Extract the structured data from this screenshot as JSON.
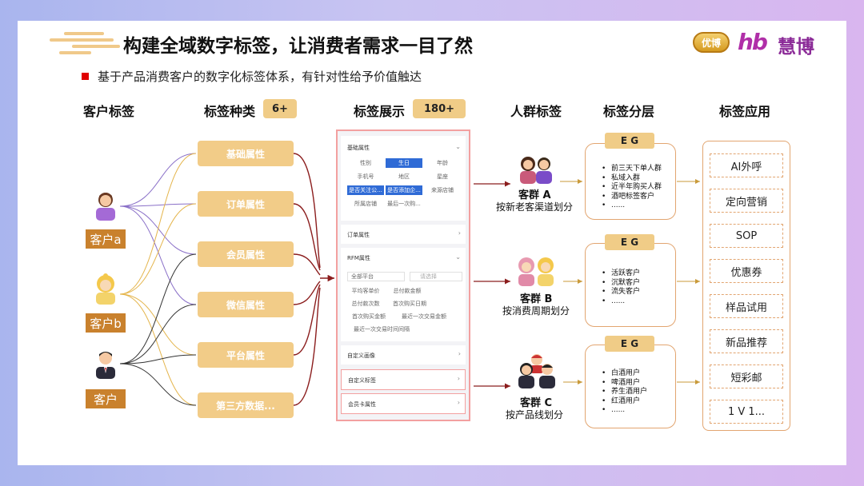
{
  "title": "构建全域数字标签，让消费者需求一目了然",
  "subtitle": "基于产品消费客户的数字化标签体系，有针对性给予价值触达",
  "logos": {
    "youbo": "优博",
    "hb": "hb",
    "huibo": "慧博"
  },
  "columns": {
    "customer_tags": "客户标签",
    "tag_types": "标签种类",
    "tag_types_badge": "6+",
    "tag_display": "标签展示",
    "tag_display_badge": "180+",
    "crowd_tags": "人群标签",
    "tag_layers": "标签分层",
    "tag_apps": "标签应用"
  },
  "customers": [
    {
      "label": "客户a",
      "icon": "woman-avatar-icon"
    },
    {
      "label": "客户b",
      "icon": "blonde-avatar-icon"
    },
    {
      "label": "客户",
      "icon": "man-in-suit-avatar-icon"
    }
  ],
  "categories": [
    "基础属性",
    "订单属性",
    "会员属性",
    "微信属性",
    "平台属性",
    "第三方数据..."
  ],
  "panel": {
    "basic": {
      "title": "基础属性",
      "chips": [
        "性别",
        "生日",
        "年龄",
        "手机号",
        "地区",
        "星座",
        "是否关注公...",
        "是否添加企...",
        "来源店铺",
        "所属店铺",
        "最后一次购..."
      ]
    },
    "order": {
      "title": "订单属性"
    },
    "rfm": {
      "title": "RFM属性",
      "select_platform": "全部平台",
      "select_placeholder": "请选择",
      "chips": [
        "平均客单价",
        "总付款金额",
        "总付款次数",
        "首次购买日期",
        "首次购买金额",
        "最近一次交易金额",
        "最近一次交易时间间隔"
      ]
    },
    "custom_portrait": {
      "title": "自定义画像"
    },
    "custom_tags": {
      "title": "自定义标签"
    },
    "member_card": {
      "title": "会员卡属性"
    }
  },
  "groups": [
    {
      "name": "客群 A",
      "desc": "按新老客渠道划分",
      "icon": "couple-avatar-icon"
    },
    {
      "name": "客群 B",
      "desc": "按消费周期划分",
      "icon": "two-women-avatar-icon"
    },
    {
      "name": "客群 C",
      "desc": "按产品线划分",
      "icon": "three-people-avatar-icon"
    }
  ],
  "layers": [
    {
      "tag": "E G",
      "items": [
        "前三天下单人群",
        "私域入群",
        "近半年购买人群",
        "酒吧标签客户",
        "......"
      ]
    },
    {
      "tag": "E G",
      "items": [
        "活跃客户",
        "沉默客户",
        "流失客户",
        "......"
      ]
    },
    {
      "tag": "E G",
      "items": [
        "白酒用户",
        "啤酒用户",
        "养生酒用户",
        "红酒用户",
        "......"
      ]
    }
  ],
  "apps": [
    "AI外呼",
    "定向营销",
    "SOP",
    "优惠券",
    "样品试用",
    "新品推荐",
    "短彩邮",
    "1 V 1..."
  ],
  "colors": {
    "accent_gold": "#f0cc87",
    "customer_brown": "#c9812d",
    "selected_blue": "#2f6bd6",
    "line_red": "#8b1d1d",
    "border_orange": "#e2a570"
  }
}
